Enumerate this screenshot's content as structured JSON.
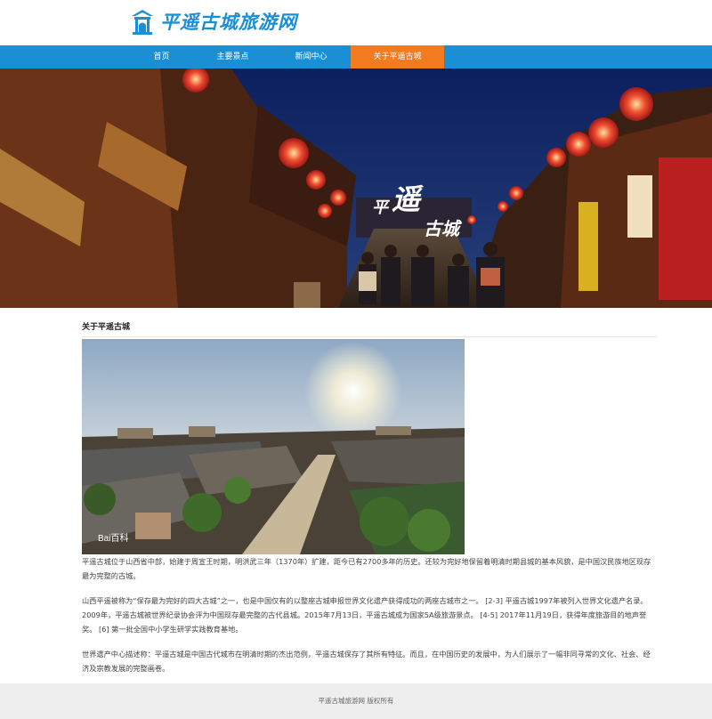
{
  "header": {
    "site_name": "平遥古城旅游网"
  },
  "nav": {
    "items": [
      {
        "label": "首页"
      },
      {
        "label": "主要景点"
      },
      {
        "label": "新闻中心"
      },
      {
        "label": "关于平遥古城"
      }
    ],
    "active_index": 3
  },
  "banner": {
    "title_part1": "平",
    "title_part2": "遥",
    "title_part3": "古城"
  },
  "about": {
    "title": "关于平遥古城",
    "photo_watermark": "Bai百科",
    "paragraphs": [
      "平遥古城位于山西省中部，始建于周宣王时期，明洪武三年（1370年）扩建，距今已有2700多年的历史。还较为完好地保留着明清时期县城的基本风貌，是中国汉民族地区现存最为完整的古城。",
      "山西平遥被称为“保存最为完好的四大古城”之一，也是中国仅有的以整座古城申报世界文化遗产获得成功的两座古城市之一。 [2-3] 平遥古城1997年被列入世界文化遗产名录。2009年，平遥古城被世界纪录协会评为中国现存最完整的古代县城。2015年7月13日，平遥古城成为国家5A级旅游景点。 [4-5] 2017年11月19日，获得年度旅游目的地声誉奖。 [6] 第一批全国中小学生研学实践教育基地。",
      "世界遗产中心描述称：平遥古城是中国古代城市在明清时期的杰出范例，平遥古城保存了其所有特征。而且，在中国历史的发展中，为人们展示了一幅非同寻常的文化、社会、经济及宗教发展的完整画卷。"
    ]
  },
  "footer": {
    "text": "平遥古城旅游网 版权所有"
  },
  "colors": {
    "nav": "#1a8fd6",
    "nav_active": "#f47a20",
    "footer_bg": "#eeeeee"
  }
}
